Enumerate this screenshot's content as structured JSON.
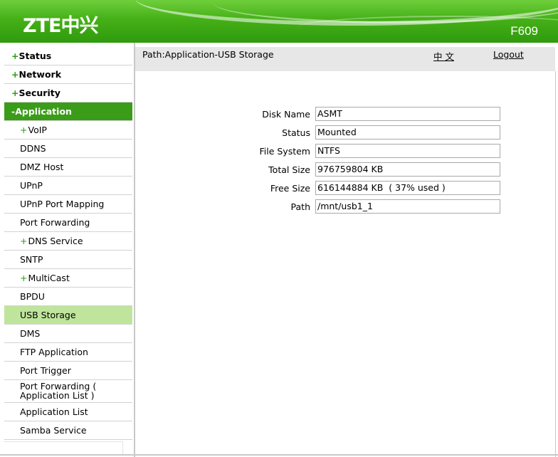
{
  "header": {
    "logo_text": "ZTE中兴",
    "model": "F609"
  },
  "path_bar": {
    "path": "Path:Application-USB Storage",
    "language_link": "中 文",
    "logout": "Logout"
  },
  "sidebar": {
    "top": [
      {
        "sign": "+",
        "label": "Status"
      },
      {
        "sign": "+",
        "label": "Network"
      },
      {
        "sign": "+",
        "label": "Security"
      }
    ],
    "application": {
      "sign": "-",
      "label": "Application"
    },
    "items": [
      {
        "sign": "+",
        "label": "VoIP"
      },
      {
        "sign": "",
        "label": "DDNS"
      },
      {
        "sign": "",
        "label": "DMZ Host"
      },
      {
        "sign": "",
        "label": "UPnP"
      },
      {
        "sign": "",
        "label": "UPnP Port Mapping"
      },
      {
        "sign": "",
        "label": "Port Forwarding"
      },
      {
        "sign": "+",
        "label": "DNS Service"
      },
      {
        "sign": "",
        "label": "SNTP"
      },
      {
        "sign": "+",
        "label": "MultiCast"
      },
      {
        "sign": "",
        "label": "BPDU"
      },
      {
        "sign": "",
        "label": "USB Storage"
      },
      {
        "sign": "",
        "label": "DMS"
      },
      {
        "sign": "",
        "label": "FTP Application"
      },
      {
        "sign": "",
        "label": "Port Trigger"
      },
      {
        "sign": "",
        "label_line1": "Port Forwarding (",
        "label_line2": "Application List )"
      },
      {
        "sign": "",
        "label": "Application List"
      },
      {
        "sign": "",
        "label": "Samba Service"
      }
    ]
  },
  "storage": {
    "disk_name_label": "Disk Name",
    "disk_name": "ASMT",
    "status_label": "Status",
    "status": "Mounted",
    "file_system_label": "File System",
    "file_system": "NTFS",
    "total_size_label": "Total Size",
    "total_size": "976759804 KB",
    "free_size_label": "Free Size",
    "free_size": "616144884 KB  ( 37% used )",
    "path_label": "Path",
    "path": "/mnt/usb1_1"
  },
  "colors": {
    "brand_green": "#45b017",
    "active_menu": "#3b9c19",
    "selected_menu": "#bfe59c"
  }
}
